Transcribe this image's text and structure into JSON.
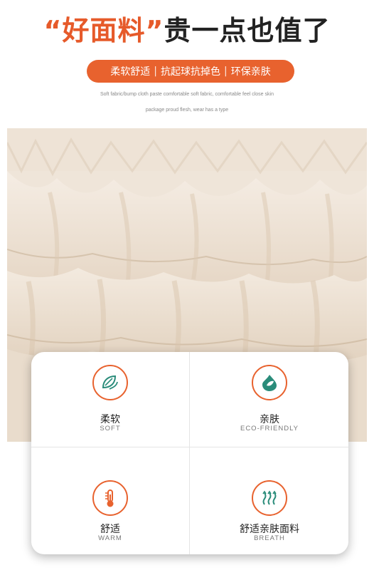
{
  "header": {
    "title_accent": "“好面料”",
    "title_rest": "贵一点也值了"
  },
  "pill": {
    "items": [
      "柔软舒适",
      "抗起球抗掉色",
      "环保亲肤"
    ],
    "separator": "|"
  },
  "subtitle": {
    "line1": "Soft fabric/bump cloth paste comfortable soft fabric, comfortable feel close skin",
    "line2": "package proud flesh, wear has a type"
  },
  "features": [
    {
      "cn": "柔软",
      "en": "SOFT",
      "icon": "leaf-icon"
    },
    {
      "cn": "亲肤",
      "en": "ECO-FRIENDLY",
      "icon": "water-drop-leaf-icon"
    },
    {
      "cn": "舒适",
      "en": "WARM",
      "icon": "thermometer-icon"
    },
    {
      "cn": "舒适亲肤面料",
      "en": "BREATH",
      "icon": "breath-waves-icon"
    }
  ],
  "colors": {
    "accent": "#e8622e",
    "icon_green": "#2a8c7a",
    "fabric": "#efe6db"
  }
}
